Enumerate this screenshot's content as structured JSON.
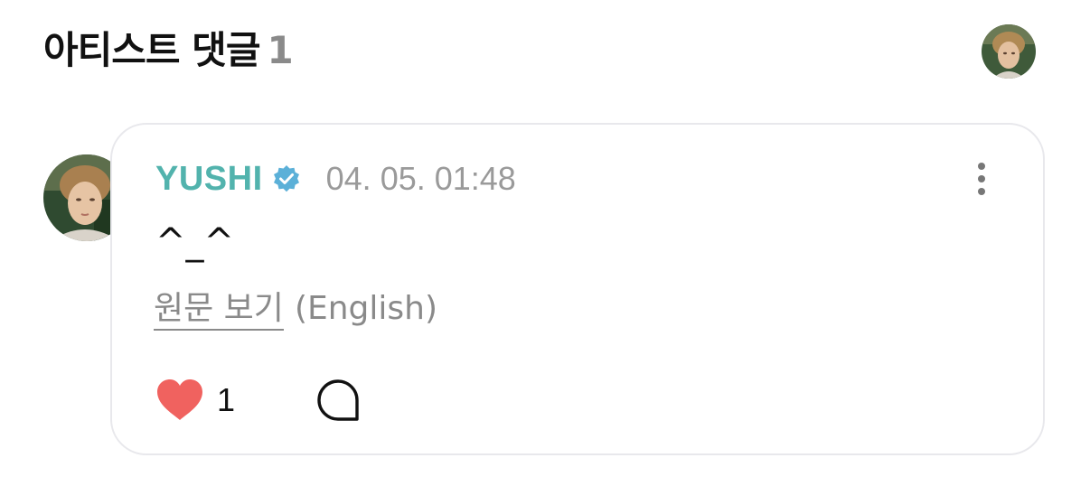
{
  "section": {
    "title": "아티스트 댓글",
    "count": "1"
  },
  "comment": {
    "author": "YUSHI",
    "verified_icon": "verified-badge-icon",
    "timestamp": "04. 05. 01:48",
    "text": "^_^",
    "view_original_label": "원문 보기",
    "original_language": "(English)",
    "like_count": "1",
    "liked": true
  },
  "colors": {
    "accent": "#52b3ad",
    "verified": "#5bb0d8",
    "heart": "#f0625f",
    "muted": "#8a8a8a",
    "card_border": "#e8e8ec"
  },
  "icons": {
    "like": "heart-icon",
    "reply": "speech-bubble-icon",
    "more": "more-vertical-icon"
  }
}
